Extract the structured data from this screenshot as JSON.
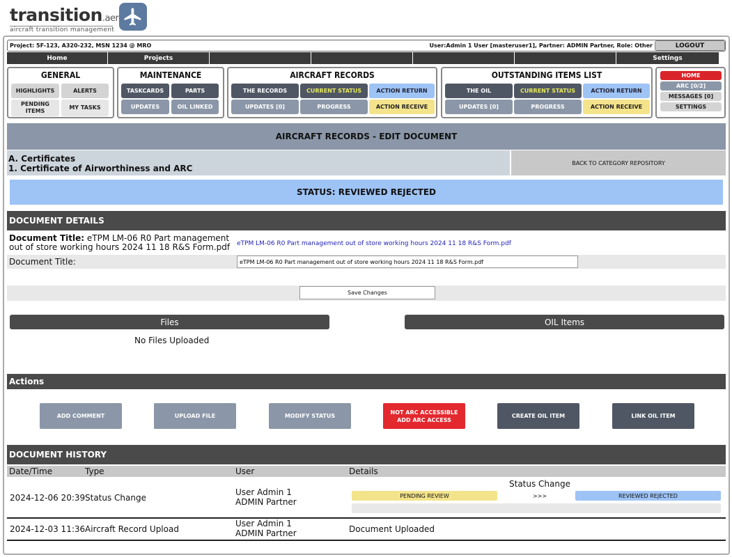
{
  "logo": {
    "name": "transition",
    "suffix": ".aero",
    "tagline": "aircraft transition management"
  },
  "project_bar": {
    "project": "Project: 5F-123, A320-232, MSN 1234 @ MRO",
    "user": "User:Admin 1 User [masteruser1], Partner: ADMIN Partner, Role: Other",
    "logout": "LOGOUT"
  },
  "nav": [
    "Home",
    "Projects",
    "",
    "",
    "",
    "",
    "Settings"
  ],
  "general": {
    "title": "GENERAL",
    "highlights": "HIGHLIGHTS",
    "alerts": "ALERTS",
    "pending_items": "PENDING ITEMS",
    "my_tasks": "MY TASKS"
  },
  "maintenance": {
    "title": "MAINTENANCE",
    "taskcards": "TASKCARDS",
    "parts": "PARTS",
    "updates": "UPDATES",
    "oil_linked": "OIL LINKED"
  },
  "aircraft_records": {
    "title": "AIRCRAFT RECORDS",
    "the_records": "THE RECORDS",
    "current_status": "CURRENT STATUS",
    "action_return": "ACTION RETURN",
    "updates": "UPDATES [0]",
    "progress": "PROGRESS",
    "action_receive": "ACTION RECEIVE"
  },
  "oil": {
    "title": "OUTSTANDING ITEMS LIST",
    "the_oil": "THE OIL",
    "current_status": "CURRENT STATUS",
    "action_return": "ACTION RETURN",
    "updates": "UPDATES [0]",
    "progress": "PROGRESS",
    "action_receive": "ACTION RECEIVE"
  },
  "quick": {
    "home": "HOME",
    "arc": "ARC [0/2]",
    "messages": "MESSAGES [0]",
    "settings": "SETTINGS"
  },
  "page_title": "AIRCRAFT RECORDS - EDIT DOCUMENT",
  "category": {
    "line1": "A. Certificates",
    "line2": "1. Certificate of Airworthiness and ARC"
  },
  "back_button": "BACK TO CATEGORY REPOSITORY",
  "status": "STATUS: REVIEWED REJECTED",
  "document_details": {
    "header": "DOCUMENT DETAILS",
    "title_label": "Document Title:",
    "title_value": "eTPM LM-06 R0 Part management out of store working hours 2024 11 18 R&S Form.pdf",
    "link_text": "eTPM LM-06 R0 Part management out of store working hours 2024 11 18 R&S Form.pdf",
    "edit_label": "Document Title:",
    "edit_value": "eTPM LM-06 R0 Part management out of store working hours 2024 11 18 R&S Form.pdf",
    "save_button": "Save Changes"
  },
  "files": {
    "header": "Files",
    "empty": "No Files Uploaded"
  },
  "oil_items": {
    "header": "OIL Items"
  },
  "actions": {
    "header": "Actions",
    "add_comment": "ADD COMMENT",
    "upload_file": "UPLOAD FILE",
    "modify_status": "MODIFY STATUS",
    "arc_line1": "NOT ARC ACCESSIBLE",
    "arc_line2": "ADD ARC ACCESS",
    "create_oil": "CREATE OIL ITEM",
    "link_oil": "LINK OIL ITEM"
  },
  "history": {
    "header": "DOCUMENT HISTORY",
    "columns": [
      "Date/Time",
      "Type",
      "User",
      "Details"
    ],
    "rows": [
      {
        "date": "2024-12-06 20:39",
        "type": "Status Change",
        "user1": "User Admin 1",
        "user2": "ADMIN Partner",
        "detail_title": "Status Change",
        "from": "PENDING REVIEW",
        "arrow": ">>>",
        "to": "REVIEWED REJECTED"
      },
      {
        "date": "2024-12-03 11:36",
        "type": "Aircraft Record Upload",
        "user1": "User Admin 1",
        "user2": "ADMIN Partner",
        "detail": "Document Uploaded"
      }
    ]
  },
  "colors": {
    "dark": "#4f5764",
    "slate": "#8b97a8",
    "light_blue": "#9ec3f5",
    "yellow": "#f3e38b",
    "red": "#e3282e",
    "section": "#4a4a4a"
  },
  "icons": {
    "logo_icon": "airplane-icon"
  }
}
